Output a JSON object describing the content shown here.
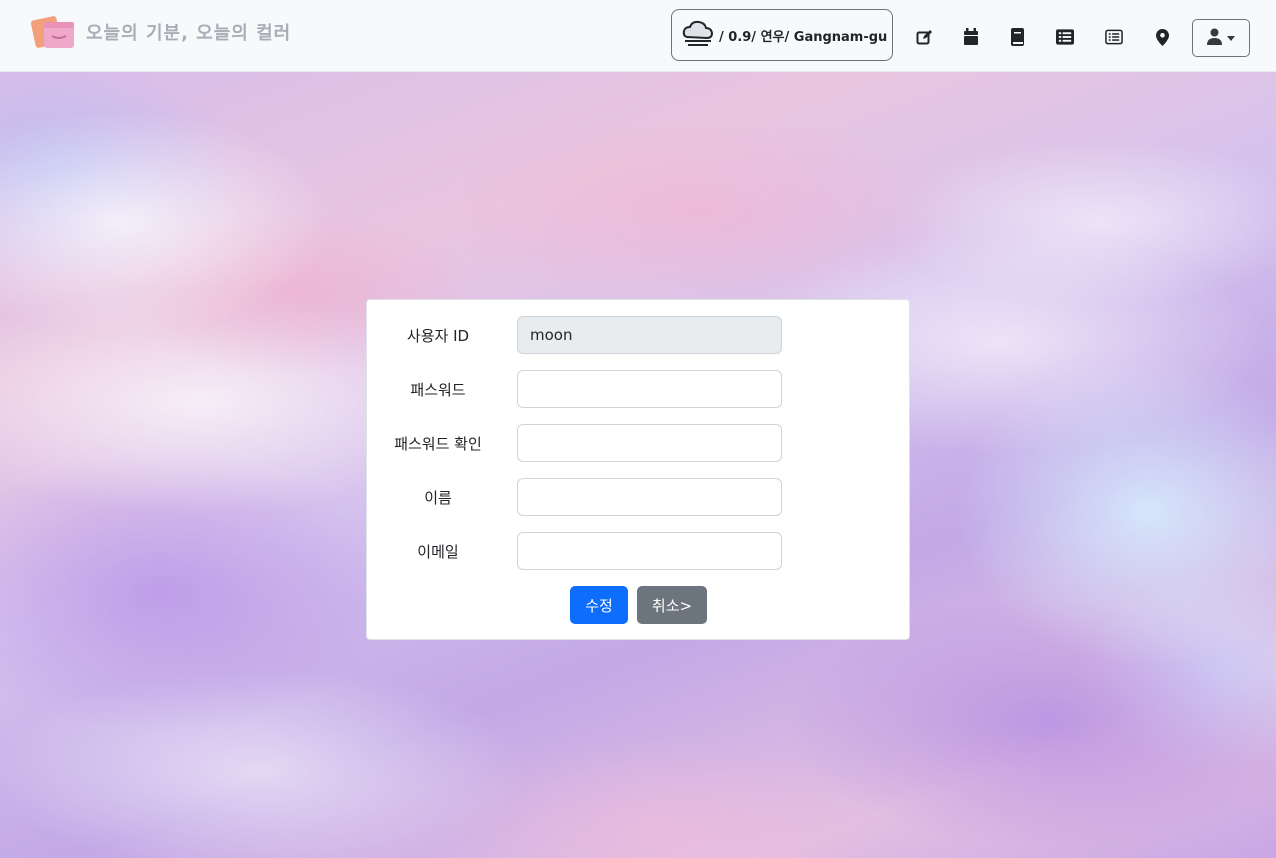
{
  "navbar": {
    "brand_text": "오늘의 기분, 오늘의 컬러",
    "weather_status": "/ 0.9/ 연우/ Gangnam-gu",
    "icons": [
      "edit-icon",
      "calendar-icon",
      "book-icon",
      "list-icon",
      "list-alt-icon",
      "map-marker-icon",
      "user-icon"
    ]
  },
  "form": {
    "fields": [
      {
        "label": "사용자 ID",
        "value": "moon",
        "readonly": true
      },
      {
        "label": "패스워드",
        "value": ""
      },
      {
        "label": "패스워드 확인",
        "value": ""
      },
      {
        "label": "이름",
        "value": ""
      },
      {
        "label": "이메일",
        "value": ""
      }
    ],
    "submit_label": "수정",
    "cancel_label": "취소>"
  },
  "colors": {
    "primary": "#0d6efd",
    "secondary": "#6c757d",
    "navbar_bg": "#f8f9fa"
  }
}
